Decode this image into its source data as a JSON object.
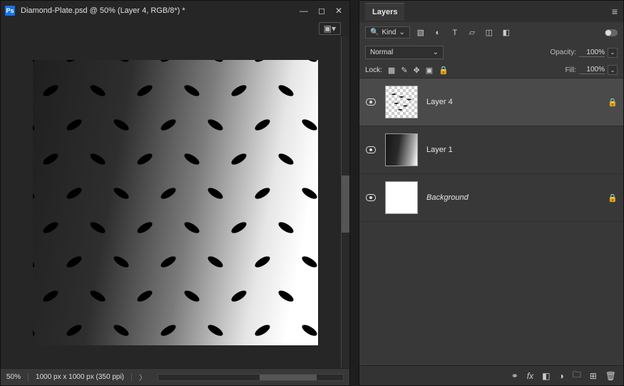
{
  "document": {
    "title": "Diamond-Plate.psd @ 50% (Layer 4, RGB/8*) *",
    "zoom": "50%",
    "info": "1000 px x 1000 px (350 ppi)"
  },
  "layers_panel": {
    "title": "Layers",
    "filter_label": "Kind",
    "blend_mode": "Normal",
    "opacity_label": "Opacity:",
    "opacity_value": "100%",
    "lock_label": "Lock:",
    "fill_label": "Fill:",
    "fill_value": "100%",
    "layers": [
      {
        "name": "Layer 4",
        "locked": true,
        "selected": true,
        "visible": true,
        "thumb": "l4"
      },
      {
        "name": "Layer 1",
        "locked": false,
        "selected": false,
        "visible": true,
        "thumb": "l1"
      },
      {
        "name": "Background",
        "locked": true,
        "selected": false,
        "visible": true,
        "thumb": "bg",
        "italic": true
      }
    ]
  }
}
